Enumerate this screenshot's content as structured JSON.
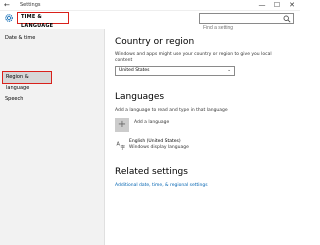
{
  "window": {
    "title": "Settings",
    "back": "←",
    "minimize": "—",
    "maximize": "☐",
    "close": "✕"
  },
  "header": {
    "section_title": "TIME & LANGUAGE",
    "search_placeholder": "Find a setting"
  },
  "sidebar": {
    "items": [
      {
        "label": "Date & time"
      },
      {
        "label": "Region & language",
        "selected": true
      },
      {
        "label": "Speech"
      }
    ]
  },
  "country": {
    "heading": "Country or region",
    "description": "Windows and apps might use your country or region to give you local content",
    "selected_value": "United States",
    "dropdown_arrow": "⌄"
  },
  "languages": {
    "heading": "Languages",
    "description": "Add a language to read and type in that language",
    "add_symbol": "+",
    "add_label": "Add a language",
    "entries": [
      {
        "name": "English (United States)",
        "sub": "Windows display language"
      }
    ]
  },
  "related": {
    "heading": "Related settings",
    "link": "Additional date, time, & regional settings"
  },
  "colors": {
    "accent": "#0063b1",
    "highlight_border": "#d9211b",
    "sidebar_bg": "#f2f2f2"
  }
}
